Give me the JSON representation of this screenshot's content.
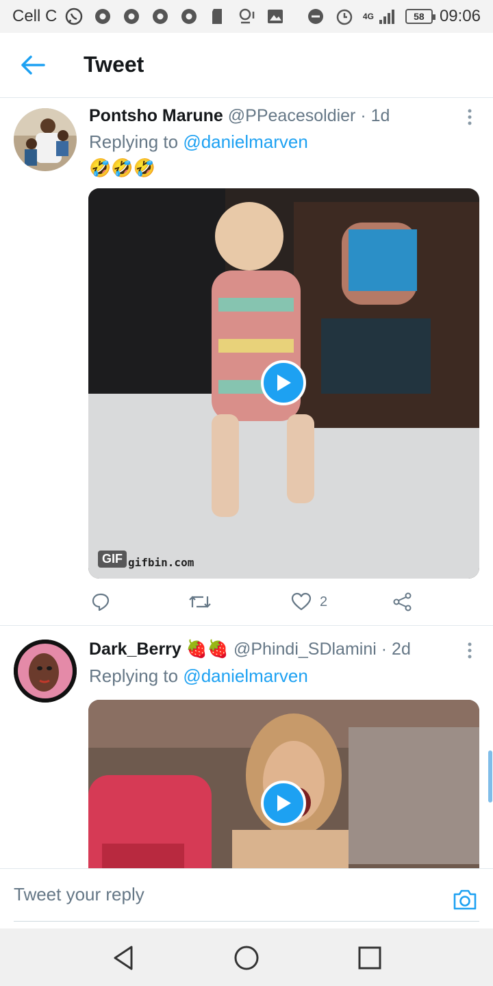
{
  "status_bar": {
    "carrier": "Cell C",
    "network": "4G",
    "battery": "58",
    "time": "09:06"
  },
  "header": {
    "title": "Tweet"
  },
  "tweets": [
    {
      "name": "Pontsho Marune",
      "handle": "@PPeacesoldier",
      "separator": "·",
      "age": "1d",
      "replying_prefix": "Replying to",
      "replying_to": "@danielmarven",
      "text": "🤣🤣🤣",
      "media_badge": "GIF",
      "media_watermark": "gifbin.com",
      "like_count": "2"
    },
    {
      "name": "Dark_Berry",
      "name_decoration": "🍓🍓",
      "handle": "@Phindi_SDlamini",
      "separator": "·",
      "age": "2d",
      "replying_prefix": "Replying to",
      "replying_to": "@danielmarven"
    }
  ],
  "composer": {
    "placeholder": "Tweet your reply"
  },
  "colors": {
    "accent": "#1da1f2",
    "text_secondary": "#657786",
    "divider": "#e1e8ed"
  }
}
